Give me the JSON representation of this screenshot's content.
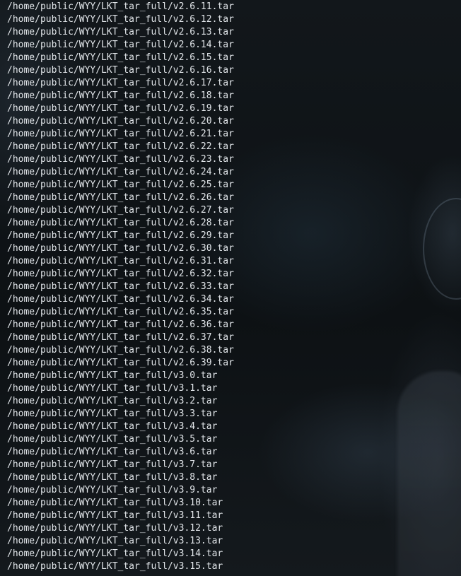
{
  "terminal": {
    "lines": [
      "/home/public/WYY/LKT_tar_full/v2.6.11.tar",
      "/home/public/WYY/LKT_tar_full/v2.6.12.tar",
      "/home/public/WYY/LKT_tar_full/v2.6.13.tar",
      "/home/public/WYY/LKT_tar_full/v2.6.14.tar",
      "/home/public/WYY/LKT_tar_full/v2.6.15.tar",
      "/home/public/WYY/LKT_tar_full/v2.6.16.tar",
      "/home/public/WYY/LKT_tar_full/v2.6.17.tar",
      "/home/public/WYY/LKT_tar_full/v2.6.18.tar",
      "/home/public/WYY/LKT_tar_full/v2.6.19.tar",
      "/home/public/WYY/LKT_tar_full/v2.6.20.tar",
      "/home/public/WYY/LKT_tar_full/v2.6.21.tar",
      "/home/public/WYY/LKT_tar_full/v2.6.22.tar",
      "/home/public/WYY/LKT_tar_full/v2.6.23.tar",
      "/home/public/WYY/LKT_tar_full/v2.6.24.tar",
      "/home/public/WYY/LKT_tar_full/v2.6.25.tar",
      "/home/public/WYY/LKT_tar_full/v2.6.26.tar",
      "/home/public/WYY/LKT_tar_full/v2.6.27.tar",
      "/home/public/WYY/LKT_tar_full/v2.6.28.tar",
      "/home/public/WYY/LKT_tar_full/v2.6.29.tar",
      "/home/public/WYY/LKT_tar_full/v2.6.30.tar",
      "/home/public/WYY/LKT_tar_full/v2.6.31.tar",
      "/home/public/WYY/LKT_tar_full/v2.6.32.tar",
      "/home/public/WYY/LKT_tar_full/v2.6.33.tar",
      "/home/public/WYY/LKT_tar_full/v2.6.34.tar",
      "/home/public/WYY/LKT_tar_full/v2.6.35.tar",
      "/home/public/WYY/LKT_tar_full/v2.6.36.tar",
      "/home/public/WYY/LKT_tar_full/v2.6.37.tar",
      "/home/public/WYY/LKT_tar_full/v2.6.38.tar",
      "/home/public/WYY/LKT_tar_full/v2.6.39.tar",
      "/home/public/WYY/LKT_tar_full/v3.0.tar",
      "/home/public/WYY/LKT_tar_full/v3.1.tar",
      "/home/public/WYY/LKT_tar_full/v3.2.tar",
      "/home/public/WYY/LKT_tar_full/v3.3.tar",
      "/home/public/WYY/LKT_tar_full/v3.4.tar",
      "/home/public/WYY/LKT_tar_full/v3.5.tar",
      "/home/public/WYY/LKT_tar_full/v3.6.tar",
      "/home/public/WYY/LKT_tar_full/v3.7.tar",
      "/home/public/WYY/LKT_tar_full/v3.8.tar",
      "/home/public/WYY/LKT_tar_full/v3.9.tar",
      "/home/public/WYY/LKT_tar_full/v3.10.tar",
      "/home/public/WYY/LKT_tar_full/v3.11.tar",
      "/home/public/WYY/LKT_tar_full/v3.12.tar",
      "/home/public/WYY/LKT_tar_full/v3.13.tar",
      "/home/public/WYY/LKT_tar_full/v3.14.tar",
      "/home/public/WYY/LKT_tar_full/v3.15.tar"
    ]
  },
  "colors": {
    "text": "#e2e6ea",
    "background": "#0f1215"
  }
}
